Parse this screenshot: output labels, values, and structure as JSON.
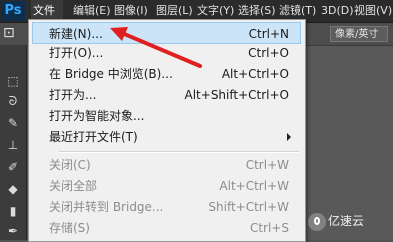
{
  "app": {
    "logo": "Ps"
  },
  "menubar": {
    "items": [
      {
        "label": "文件(F)"
      },
      {
        "label": "编辑(E)"
      },
      {
        "label": "图像(I)"
      },
      {
        "label": "图层(L)"
      },
      {
        "label": "文字(Y)"
      },
      {
        "label": "选择(S)"
      },
      {
        "label": "滤镜(T)"
      },
      {
        "label": "3D(D)"
      },
      {
        "label": "视图(V)"
      }
    ]
  },
  "options_bar": {
    "units_dropdown": "像素/英寸"
  },
  "file_menu": {
    "items": [
      {
        "label": "新建(N)...",
        "shortcut": "Ctrl+N",
        "highlighted": true
      },
      {
        "label": "打开(O)...",
        "shortcut": "Ctrl+O"
      },
      {
        "label": "在 Bridge 中浏览(B)...",
        "shortcut": "Alt+Ctrl+O"
      },
      {
        "label": "打开为...",
        "shortcut": "Alt+Shift+Ctrl+O"
      },
      {
        "label": "打开为智能对象...",
        "shortcut": ""
      },
      {
        "label": "最近打开文件(T)",
        "shortcut": "",
        "submenu": true
      },
      {
        "label": "关闭(C)",
        "shortcut": "Ctrl+W",
        "disabled": true
      },
      {
        "label": "关闭全部",
        "shortcut": "Alt+Ctrl+W",
        "disabled": true
      },
      {
        "label": "关闭并转到 Bridge...",
        "shortcut": "Shift+Ctrl+W",
        "disabled": true
      },
      {
        "label": "存储(S)",
        "shortcut": "Ctrl+S",
        "disabled": true
      }
    ]
  },
  "watermark": {
    "text": "亿速云"
  },
  "colors": {
    "annotation_arrow": "#e02020",
    "highlight": "#cce4f7"
  }
}
